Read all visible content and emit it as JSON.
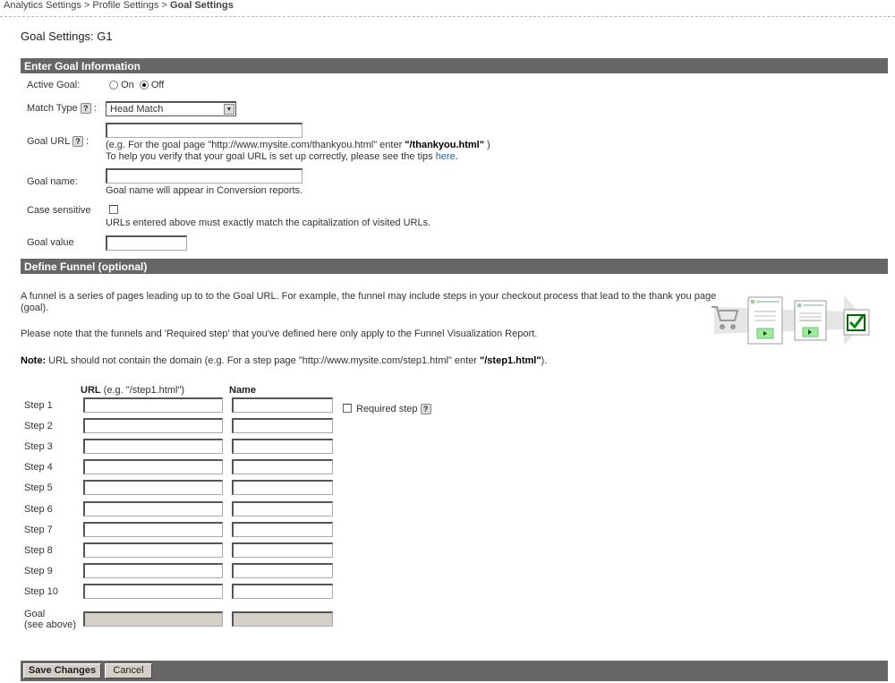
{
  "breadcrumb": {
    "items": [
      "Analytics Settings",
      "Profile Settings"
    ],
    "current": "Goal Settings",
    "sep": ">"
  },
  "page_title": "Goal Settings: G1",
  "goal_info": {
    "header": "Enter Goal Information",
    "active_goal": {
      "label": "Active Goal:",
      "on": "On",
      "off": "Off",
      "selected": "Off"
    },
    "match_type": {
      "label": "Match Type",
      "colon": ":",
      "value": "Head Match"
    },
    "goal_url": {
      "label": "Goal URL",
      "colon": ":",
      "value": "",
      "hint_pre": "(e.g. For the goal page \"http://www.mysite.com/thankyou.html\" enter ",
      "hint_bold": "\"/thankyou.html\"",
      "hint_post": " )",
      "tip_pre": "To help you verify that your goal URL is set up correctly, please see the tips ",
      "tip_link": "here",
      "tip_post": "."
    },
    "goal_name": {
      "label": "Goal name:",
      "value": "",
      "hint": "Goal name will appear in Conversion reports."
    },
    "case_sensitive": {
      "label": "Case sensitive",
      "checked": false,
      "hint": "URLs entered above must exactly match the capitalization of visited URLs."
    },
    "goal_value": {
      "label": "Goal value",
      "value": ""
    }
  },
  "funnel": {
    "header": "Define Funnel (optional)",
    "para1": "A funnel is a series of pages leading up to to the Goal URL. For example, the funnel may include steps in your checkout process that lead to the thank you page",
    "para1b": "(goal).",
    "para2": "Please note that the funnels and 'Required step' that you've defined here only apply to the Funnel Visualization Report.",
    "note_label": "Note:",
    "note_pre": " URL should not contain the domain (e.g. For a step page \"http://www.mysite.com/step1.html\" enter ",
    "note_bold": "\"/step1.html\"",
    "note_post": ").",
    "col_url": "URL",
    "col_url_hint": " (e.g. \"/step1.html\")",
    "col_name": "Name",
    "required_step": "Required step",
    "steps": [
      "Step 1",
      "Step 2",
      "Step 3",
      "Step 4",
      "Step 5",
      "Step 6",
      "Step 7",
      "Step 8",
      "Step 9",
      "Step 10"
    ],
    "goal_label1": "Goal",
    "goal_label2": "(see above)"
  },
  "footer": {
    "save": "Save Changes",
    "cancel": "Cancel"
  },
  "colors": {
    "header_bar": "#666666",
    "link": "#1a5fb4",
    "disabled_input": "#d4d0c8"
  }
}
